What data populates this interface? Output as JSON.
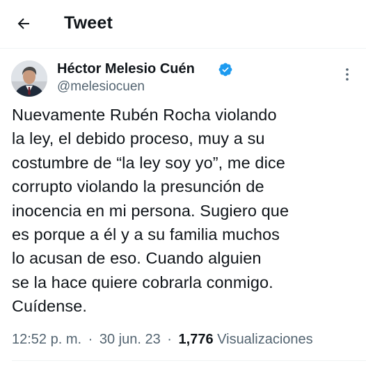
{
  "header": {
    "title": "Tweet",
    "back_icon": "arrow-left-icon"
  },
  "tweet": {
    "author": {
      "name": "Héctor Melesio Cuén",
      "handle": "@melesiocuen",
      "verified": true,
      "verified_color": "#1d9bf0"
    },
    "text": "Nuevamente Rubén Rocha violando\nla ley, el debido proceso, muy a su\ncostumbre de “la ley soy yo”, me dice\ncorrupto violando la presunción de\ninocencia en mi persona. Sugiero que\nes porque a él y a su familia muchos\nlo acusan de eso. Cuando alguien\nse la hace quiere cobrarla conmigo.\nCuídense.",
    "time": "12:52 p. m.",
    "date": "30 jun. 23",
    "separator": "·",
    "views_count": "1,776",
    "views_label": "Visualizaciones",
    "more_icon": "more-vertical-icon"
  }
}
